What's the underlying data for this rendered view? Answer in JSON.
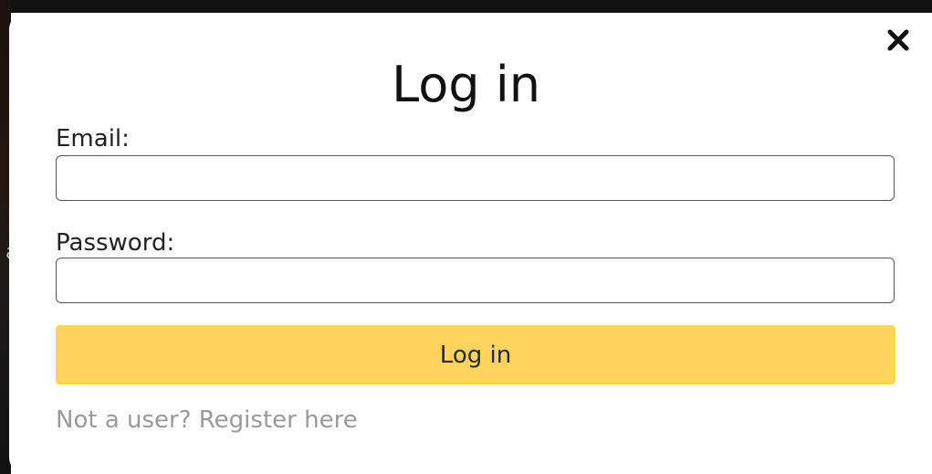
{
  "modal": {
    "title": "Log in",
    "close_icon": "close-icon",
    "email": {
      "label": "Email:",
      "value": "",
      "placeholder": ""
    },
    "password": {
      "label": "Password:",
      "value": "",
      "placeholder": ""
    },
    "submit_label": "Log in",
    "register_link": "Not a user? Register here",
    "colors": {
      "submit_button": "#ffd45c",
      "register_link": "#9a9a9a",
      "title": "#111111"
    }
  }
}
